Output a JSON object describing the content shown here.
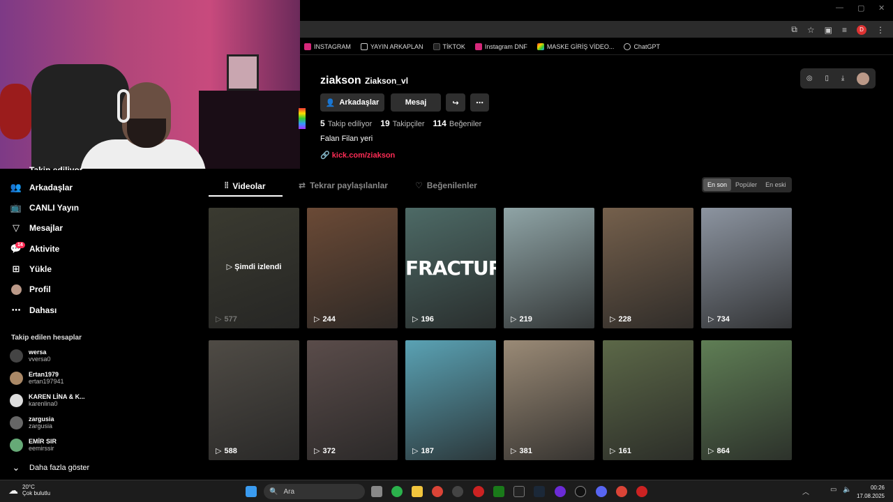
{
  "bookmarks": [
    "INSTAGRAM",
    "YAYIN ARKAPLAN",
    "TİKTOK",
    "Instagram DNF",
    "MASKE GİRİŞ VİDEO...",
    "ChatGPT"
  ],
  "browser": {
    "profile_initial": "D"
  },
  "sidebar": {
    "partial_item": "Takip ediliyor",
    "items": [
      {
        "label": "Arkadaşlar",
        "icon": "friends-icon"
      },
      {
        "label": "CANLI Yayın",
        "icon": "live-icon"
      },
      {
        "label": "Mesajlar",
        "icon": "messages-icon"
      },
      {
        "label": "Aktivite",
        "icon": "activity-icon",
        "badge": "14"
      },
      {
        "label": "Yükle",
        "icon": "upload-icon"
      },
      {
        "label": "Profil",
        "icon": "profile-icon"
      },
      {
        "label": "Dahası",
        "icon": "more-icon"
      }
    ],
    "following_header": "Takip edilen hesaplar",
    "accounts": [
      {
        "name": "wersa",
        "user": "vversa0"
      },
      {
        "name": "Ertan1979",
        "user": "ertan197941"
      },
      {
        "name": "KAREN LİNA & K...",
        "user": "karenlina0"
      },
      {
        "name": "zargusia",
        "user": "zargusia"
      },
      {
        "name": "EMİR SIR",
        "user": "eemirssir"
      }
    ],
    "show_more": "Daha fazla göster"
  },
  "profile": {
    "handle": "ziakson",
    "nickname": "Ziakson_vl",
    "friends_btn": "Arkadaşlar",
    "message_btn": "Mesaj",
    "stats": [
      {
        "value": "5",
        "label": "Takip ediliyor"
      },
      {
        "value": "19",
        "label": "Takipçiler"
      },
      {
        "value": "114",
        "label": "Beğeniler"
      }
    ],
    "bio": "Falan Filan yeri",
    "link": "kick.com/ziakson"
  },
  "tabs": [
    "Videolar",
    "Tekrar paylaşılanlar",
    "Beğenilenler"
  ],
  "sort": [
    "En son",
    "Popüler",
    "En eski"
  ],
  "videos": [
    {
      "views": "577",
      "watched": "Şimdi izlendi",
      "color": "#3a3a30"
    },
    {
      "views": "244",
      "color": "#6b4a36"
    },
    {
      "views": "196",
      "title": "FRACTURE",
      "color": "#4d6a66"
    },
    {
      "views": "219",
      "color": "#8fa4a6"
    },
    {
      "views": "228",
      "color": "#75604c"
    },
    {
      "views": "734",
      "color": "#8c94a0"
    },
    {
      "views": "588",
      "color": "#4f4b45"
    },
    {
      "views": "372",
      "color": "#5a4c4a"
    },
    {
      "views": "187",
      "color": "#5aa2b4"
    },
    {
      "views": "381",
      "color": "#9a8a76"
    },
    {
      "views": "161",
      "color": "#5c6848"
    },
    {
      "views": "864",
      "color": "#5f7e55"
    }
  ],
  "taskbar": {
    "temp": "20°C",
    "weather": "Çok bulutlu",
    "search": "Ara",
    "time": "00:26",
    "date": "17.08.2025"
  }
}
